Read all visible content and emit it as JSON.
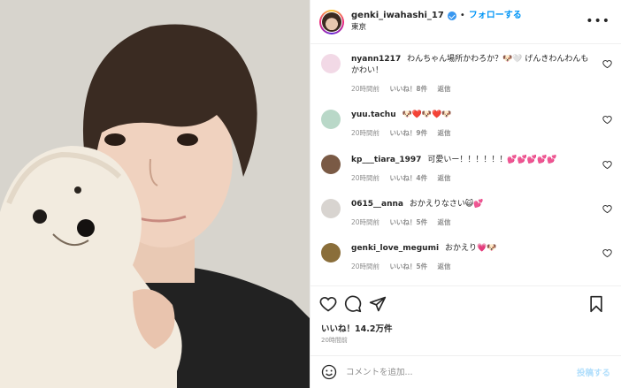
{
  "header": {
    "username": "genki_iwahashi_17",
    "separator": "•",
    "follow_label": "フォローする",
    "location": "東京",
    "more_label": "•••"
  },
  "comments": [
    {
      "user": "nyann1217",
      "text": "わんちゃん場所かわろか？🐶🤍 げんきわんわんもかわい！",
      "time": "20時間前",
      "likes": "いいね！8件",
      "reply": "返信",
      "avatar_color": "#f2d9e6"
    },
    {
      "user": "yuu.tachu",
      "text": "🐶❤️🐶❤️🐶",
      "time": "20時間前",
      "likes": "いいね！9件",
      "reply": "返信",
      "avatar_color": "#b9d8c8"
    },
    {
      "user": "kp___tiara_1997",
      "text": "可愛いー！！！！！！💕💕💕💕💕",
      "time": "20時間前",
      "likes": "いいね！4件",
      "reply": "返信",
      "avatar_color": "#7a5a45"
    },
    {
      "user": "0615__anna",
      "text": "おかえりなさい😺💕",
      "time": "20時間前",
      "likes": "いいね！5件",
      "reply": "返信",
      "avatar_color": "#d8d4d0"
    },
    {
      "user": "genki_love_megumi",
      "text": "おかえり💗🐶",
      "time": "20時間前",
      "likes": "いいね！5件",
      "reply": "返信",
      "avatar_color": "#8a6e3a"
    }
  ],
  "post": {
    "likes_total": "いいね！14.2万件",
    "time": "20時間前"
  },
  "add_comment": {
    "placeholder": "コメントを追加...",
    "post_label": "投稿する"
  },
  "colors": {
    "follow_blue": "#0095f6",
    "muted_gray": "#8e8e8e",
    "post_disabled": "#b2dffc"
  }
}
